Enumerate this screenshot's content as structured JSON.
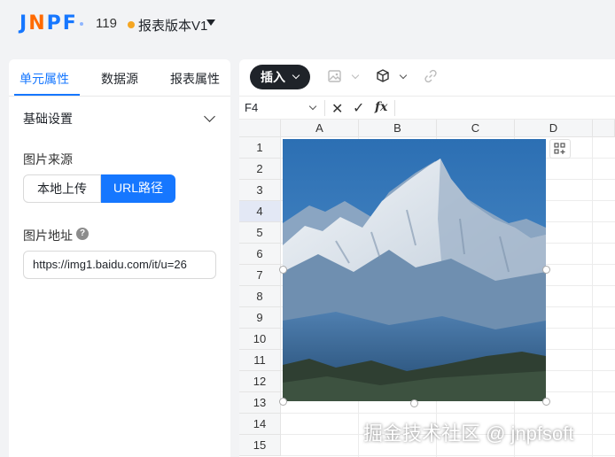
{
  "header": {
    "logo": {
      "j": "J",
      "n": "N",
      "p": "P",
      "f": "F"
    },
    "report_number": "119",
    "version_label": "报表版本V1"
  },
  "left_panel": {
    "tabs": [
      {
        "label": "单元属性",
        "active": true
      },
      {
        "label": "数据源",
        "active": false
      },
      {
        "label": "报表属性",
        "active": false
      }
    ],
    "section_title": "基础设置",
    "image_source_label": "图片来源",
    "source_options": [
      "本地上传",
      "URL路径"
    ],
    "selected_source": "URL路径",
    "image_url_label": "图片地址",
    "image_url_value": "https://img1.baidu.com/it/u=26"
  },
  "toolbar": {
    "insert_label": "插入",
    "icons": [
      "image-icon",
      "cube-icon",
      "link-icon"
    ]
  },
  "formula_bar": {
    "cell_ref": "F4",
    "cancel_symbol": "✕",
    "confirm_symbol": "✓",
    "fx_label": "fx"
  },
  "sheet": {
    "columns": [
      "A",
      "B",
      "C",
      "D"
    ],
    "rows": [
      "1",
      "2",
      "3",
      "4",
      "5",
      "6",
      "7",
      "8",
      "9",
      "10",
      "11",
      "12",
      "13",
      "14",
      "15"
    ],
    "selected_row": "4"
  },
  "watermark": "掘金技术社区 @ jnpfsoft",
  "colors": {
    "accent": "#1677ff",
    "logo_orange": "#ff6a00",
    "status_dot": "#f5a623",
    "insert_button": "#1f2329"
  }
}
